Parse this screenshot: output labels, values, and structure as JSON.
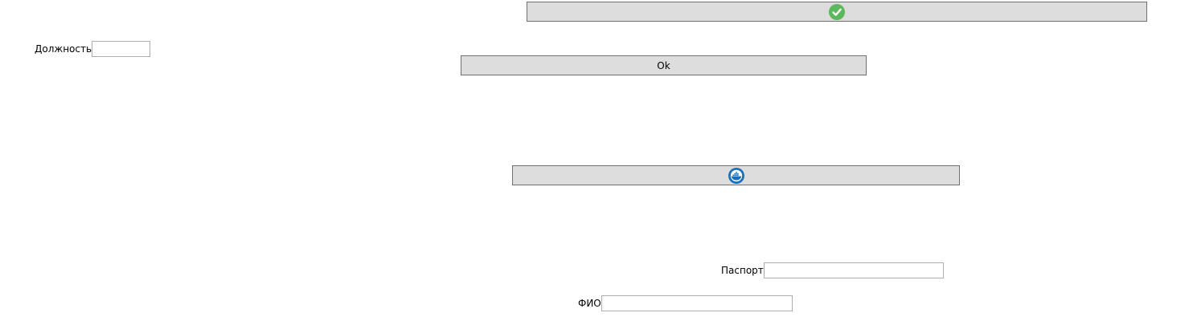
{
  "buttons": {
    "confirm": {
      "icon": "checkmark-icon",
      "icon_color": "#5cb85c"
    },
    "ok": {
      "label": "Ok"
    },
    "docker": {
      "icon": "docker-whale-icon",
      "icon_color": "#1e6fb8"
    }
  },
  "fields": {
    "position": {
      "label": "Должность",
      "value": ""
    },
    "passport": {
      "label": "Паспорт",
      "value": ""
    },
    "fio": {
      "label": "ФИО",
      "value": ""
    }
  },
  "colors": {
    "button_background": "#dddddd",
    "button_border": "#707070",
    "input_border": "#abadb3"
  }
}
